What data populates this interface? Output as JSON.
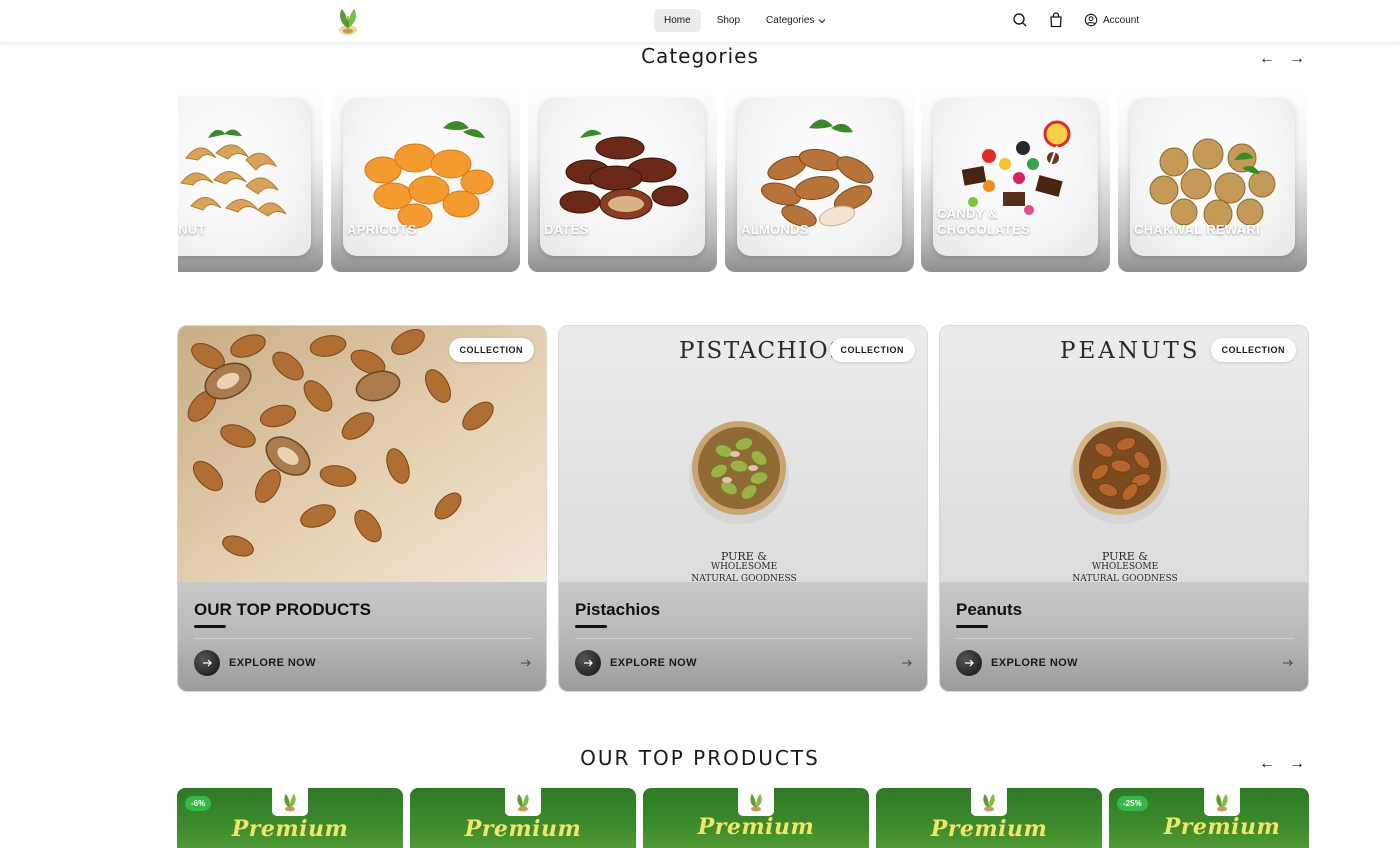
{
  "header": {
    "logo_icon": "leaf-nut-logo",
    "nav": [
      {
        "label": "Home",
        "active": true
      },
      {
        "label": "Shop",
        "active": false
      },
      {
        "label": "Categories",
        "active": false,
        "dropdown": true
      }
    ],
    "search_icon": "search-icon",
    "cart_icon": "shopping-bag-icon",
    "account_label": "Account"
  },
  "categories": {
    "title": "Categories",
    "prev": "←",
    "next": "→",
    "items": [
      {
        "label": "HEWS NUT"
      },
      {
        "label": "APRICOTS"
      },
      {
        "label": "DATES"
      },
      {
        "label": "ALMONDS"
      },
      {
        "label": "CANDY & CHOCOLATES"
      },
      {
        "label": "CHAKWAL REWARI"
      }
    ]
  },
  "collections": [
    {
      "name": "OUR TOP PRODUCTS",
      "badge": "COLLECTION",
      "cta": "EXPLORE NOW",
      "image_text": ""
    },
    {
      "name": "Pistachios",
      "badge": "COLLECTION",
      "cta": "EXPLORE NOW",
      "image_text": "PISTACHIOS",
      "tag1": "PURE &",
      "tag2": "WHOLESOME",
      "tag3": "NATURAL GOODNESS"
    },
    {
      "name": "Peanuts",
      "badge": "COLLECTION",
      "cta": "EXPLORE NOW",
      "image_text": "PEANUTS",
      "tag1": "PURE &",
      "tag2": "WHOLESOME",
      "tag3": "NATURAL GOODNESS"
    }
  ],
  "top_products": {
    "title": "OUR TOP PRODUCTS",
    "prev": "←",
    "next": "→",
    "items": [
      {
        "badge": "-6%",
        "text": "Premium"
      },
      {
        "badge": "",
        "text": "Premium"
      },
      {
        "badge": "",
        "text": "Premium"
      },
      {
        "badge": "",
        "text": "Premium"
      },
      {
        "badge": "-25%",
        "text": "Premium"
      }
    ]
  },
  "colors": {
    "accent_green": "#3c8a2d",
    "discount_green": "#35b84a",
    "premium_yellow": "#f3e46a"
  }
}
